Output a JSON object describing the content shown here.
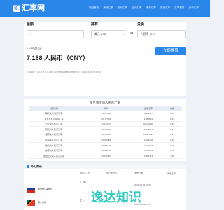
{
  "header": {
    "logo_glyph": "汇",
    "logo_text": "汇率网",
    "nav": [
      "网站首页",
      "美元汇率",
      "欧元汇率",
      "日元汇率",
      "港币汇率",
      "英镑汇率",
      "汇率换算",
      "外币汇率"
    ]
  },
  "converter": {
    "amount_label": "金额",
    "amount_value": "1",
    "hold_label": "持有",
    "hold_value": "美元 USD",
    "swap_glyph": "⇄",
    "exchange_label": "兑换",
    "exchange_value": "人民币 CNY",
    "rate_small": "1 USD(美元)=",
    "rate_big": "7.188 人民币（CNY）",
    "button_label": "立即换算",
    "note": "汇率信息：1人民币 = 0.139 USD  &nbsp;数据仅供参考  更新时间：2025-06-09 08:03:31"
  },
  "table": {
    "title": "常见货币对人民币汇率",
    "headers": [
      "货币名称",
      "代码",
      "最新汇率",
      "涨幅"
    ],
    "rows": [
      [
        "美元兑人民币汇率",
        "CNY/USD",
        "0.139117",
        "0.55"
      ],
      [
        "新台币兑人民币汇率",
        "CNY/TWD",
        "4.160861",
        "0.63"
      ],
      [
        "日元兑人民币汇率",
        "CNY/JPY",
        "20.152439",
        "0.30"
      ],
      [
        "韩元兑人民币汇率",
        "CNY/KRW",
        "190.8916",
        "0.52"
      ],
      [
        "港币兑人民币汇率",
        "CNY/HKD",
        "11.000417",
        "1.21"
      ],
      [
        "英镑兑人民币汇率",
        "CNY/GBP",
        "0.102746",
        "0.23"
      ],
      [
        "欧元兑人民币汇率",
        "CNY/EUR",
        "0.121914",
        "1.15"
      ],
      [
        "新币兑人民币汇率",
        "CNY/SGD",
        "0.179173",
        "0.08"
      ],
      [
        "新西兰元兑人民币汇率",
        "CNY/NZD",
        "0.216113",
        "4.95"
      ]
    ]
  },
  "foreign": {
    "title": "外汇牌价",
    "cols": [
      "银行买入价",
      "银行卖出价",
      "发布日期"
    ],
    "items": [
      {
        "name": "塞尔维亚第纳尔",
        "v1": "汇 732",
        "v2": "",
        "date": "2025-06-09 07:59"
      },
      {
        "name": "南非兰特",
        "v1": "汇 5",
        "v2": "",
        "date": "2025-06-09 07:59"
      }
    ],
    "stamp_text": "南非汇率"
  },
  "watermark": "逸达知识",
  "colors": {
    "brand": "#2a86e8",
    "watermark": "#21c8bd"
  }
}
